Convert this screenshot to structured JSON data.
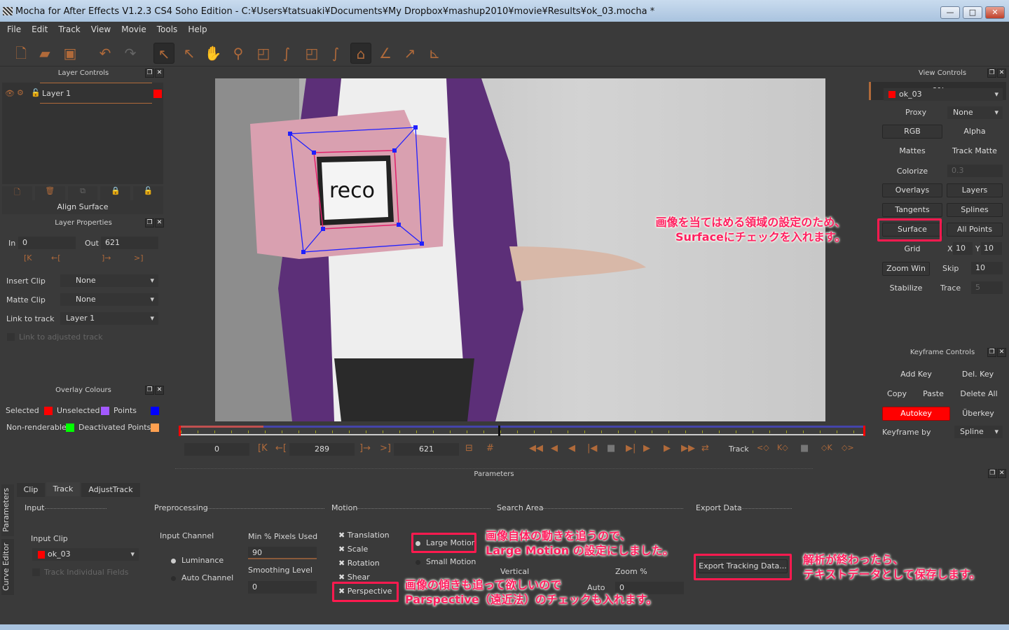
{
  "window": {
    "title": "Mocha for After Effects V1.2.3 CS4 Soho Edition - C:¥Users¥tatsuaki¥Documents¥My Dropbox¥mashup2010¥movie¥Results¥ok_03.mocha *",
    "minimize": "—",
    "maximize": "□",
    "close": "✕"
  },
  "menu": [
    "File",
    "Edit",
    "Track",
    "View",
    "Movie",
    "Tools",
    "Help"
  ],
  "toolbar": {
    "progress": "0%"
  },
  "layer_controls": {
    "title": "Layer Controls",
    "layer_name": "Layer 1",
    "layer_color": "#ff0000",
    "align_surface": "Align Surface"
  },
  "layer_properties": {
    "title": "Layer Properties",
    "in_label": "In",
    "in_value": "0",
    "out_label": "Out",
    "out_value": "621",
    "insert_clip_label": "Insert Clip",
    "insert_clip": "None",
    "matte_clip_label": "Matte Clip",
    "matte_clip": "None",
    "link_label": "Link to track",
    "link_value": "Layer 1",
    "link_adjusted": "Link to adjusted track"
  },
  "overlay_colours": {
    "title": "Overlay Colours",
    "selected": "Selected",
    "unselected": "Unselected",
    "points": "Points",
    "nonrenderable": "Non-renderable",
    "deactivated": "Deactivated Points",
    "colors": {
      "selected": "#ff0000",
      "unselected": "#a259ff",
      "points": "#0000ff",
      "nonrenderable": "#00ff00",
      "deactivated": "#ffa050"
    }
  },
  "viewer": {
    "card_text": "reco"
  },
  "timeline": {
    "start": "0",
    "current": "289",
    "end": "621",
    "track_label": "Track"
  },
  "view_controls": {
    "title": "View Controls",
    "clip": "ok_03",
    "proxy_label": "Proxy",
    "proxy": "None",
    "rgb": "RGB",
    "alpha": "Alpha",
    "mattes": "Mattes",
    "track_matte": "Track Matte",
    "colorize": "Colorize",
    "colorize_value": "0.3",
    "overlays": "Overlays",
    "layers": "Layers",
    "tangents": "Tangents",
    "splines": "Splines",
    "surface": "Surface",
    "all_points": "All Points",
    "grid": "Grid",
    "grid_x_label": "X",
    "grid_x": "10",
    "grid_y_label": "Y",
    "grid_y": "10",
    "zoom_win": "Zoom Win",
    "skip_label": "Skip",
    "skip": "10",
    "stabilize": "Stabilize",
    "trace_label": "Trace",
    "trace": "5"
  },
  "keyframe_controls": {
    "title": "Keyframe Controls",
    "add_key": "Add Key",
    "del_key": "Del. Key",
    "copy": "Copy",
    "paste": "Paste",
    "delete_all": "Delete All",
    "autokey": "Autokey",
    "uberkey": "Überkey",
    "keyframe_by_label": "Keyframe by",
    "keyframe_by": "Spline"
  },
  "parameters": {
    "title": "Parameters",
    "side_tabs": [
      "Parameters",
      "Curve Editor"
    ],
    "tabs": [
      "Clip",
      "Track",
      "AdjustTrack"
    ],
    "sections": {
      "input": "Input",
      "preprocessing": "Preprocessing",
      "motion": "Motion",
      "search_area": "Search Area",
      "export_data": "Export Data"
    },
    "input_clip_label": "Input Clip",
    "input_clip": "ok_03",
    "track_fields": "Track Individual Fields",
    "input_channel_label": "Input Channel",
    "luminance": "Luminance",
    "auto_channel": "Auto Channel",
    "min_pixels_label": "Min % Pixels Used",
    "min_pixels": "90",
    "smoothing_label": "Smoothing Level",
    "smoothing": "0",
    "motion": [
      "Translation",
      "Scale",
      "Rotation",
      "Shear",
      "Perspective"
    ],
    "large_motion": "Large Motion",
    "small_motion": "Small Motion",
    "vertical_label": "Vertical",
    "zoom_label": "Zoom %",
    "auto_label": "Auto",
    "zoom_value": "0",
    "export_button": "Export Tracking Data..."
  },
  "annotations": {
    "surface": [
      "画像を当てはめる領域の設定のため、",
      "Surfaceにチェックを入れます。"
    ],
    "large_motion": [
      "画像自体の動きを追うので、",
      "Large Motion の設定にしました。"
    ],
    "perspective": [
      "画像の傾きも追って欲しいので",
      "Parspective（遠近法）のチェックも入れます。"
    ],
    "export": [
      "解析が終わったら、",
      "テキストデータとして保存します。"
    ]
  }
}
